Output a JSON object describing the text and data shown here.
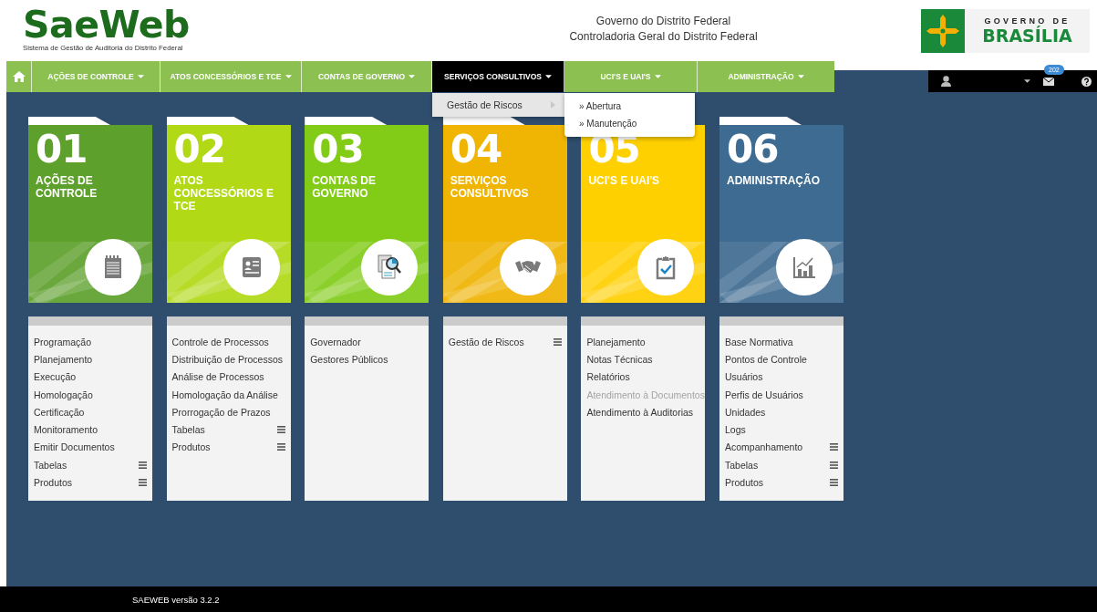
{
  "header": {
    "logo": "SaeWeb",
    "logo_subtitle": "Sistema de Gestão de Auditoria do Distrito Federal",
    "center_lines": [
      "Governo do Distrito Federal",
      "Controladoria Geral do Distrito Federal"
    ],
    "gov_logo": {
      "line_1": "GOVERNO DE",
      "line_2": "BRASÍLIA"
    }
  },
  "nav": [
    {
      "label": "AÇÕES DE CONTROLE",
      "selected": false
    },
    {
      "label": "ATOS CONCESSÓRIOS E TCE",
      "selected": false
    },
    {
      "label": "CONTAS DE GOVERNO",
      "selected": false
    },
    {
      "label": "SERVIÇOS CONSULTIVOS",
      "selected": true
    },
    {
      "label": "UCI'S E UAI'S",
      "selected": false
    },
    {
      "label": "ADMINISTRAÇÃO",
      "selected": false
    }
  ],
  "dropdown": {
    "items": [
      {
        "label": "Gestão de Riscos",
        "selected": true
      }
    ],
    "submenu": [
      {
        "label": "» Abertura"
      },
      {
        "label": "» Manutenção"
      }
    ]
  },
  "user_bar": {
    "mail_badge": "202"
  },
  "modules": [
    {
      "number": "01",
      "title": "AÇÕES DE CONTROLE",
      "color": "#5ea02c",
      "kind": "notepad",
      "items": [
        {
          "label": "Programação",
          "disabled": false,
          "submenu": false
        },
        {
          "label": "Planejamento",
          "disabled": false,
          "submenu": false
        },
        {
          "label": "Execução",
          "disabled": false,
          "submenu": false
        },
        {
          "label": "Homologação",
          "disabled": false,
          "submenu": false
        },
        {
          "label": "Certificação",
          "disabled": false,
          "submenu": false
        },
        {
          "label": "Monitoramento",
          "disabled": false,
          "submenu": false
        },
        {
          "label": "Emitir Documentos",
          "disabled": false,
          "submenu": false
        },
        {
          "label": "Tabelas",
          "disabled": false,
          "submenu": true
        },
        {
          "label": "Produtos",
          "disabled": false,
          "submenu": true
        }
      ]
    },
    {
      "number": "02",
      "title": "ATOS CONCESSÓRIOS E TCE",
      "color": "#b1d916",
      "kind": "id-card",
      "items": [
        {
          "label": "Controle de Processos",
          "disabled": false,
          "submenu": false
        },
        {
          "label": "Distribuição de Processos",
          "disabled": false,
          "submenu": false
        },
        {
          "label": "Análise de Processos",
          "disabled": false,
          "submenu": false
        },
        {
          "label": "Homologação da Análise",
          "disabled": false,
          "submenu": false
        },
        {
          "label": "Prorrogação de Prazos",
          "disabled": false,
          "submenu": false
        },
        {
          "label": "Tabelas",
          "disabled": false,
          "submenu": true
        },
        {
          "label": "Produtos",
          "disabled": false,
          "submenu": true
        }
      ]
    },
    {
      "number": "03",
      "title": "CONTAS DE GOVERNO",
      "color": "#82cc18",
      "kind": "document-search",
      "items": [
        {
          "label": "Governador",
          "disabled": false,
          "submenu": false
        },
        {
          "label": "Gestores Públicos",
          "disabled": false,
          "submenu": false
        }
      ]
    },
    {
      "number": "04",
      "title": "SERVIÇOS CONSULTIVOS",
      "color": "#f0b402",
      "kind": "handshake",
      "items": [
        {
          "label": "Gestão de Riscos",
          "disabled": false,
          "submenu": true
        }
      ]
    },
    {
      "number": "05",
      "title": "UCI'S E UAI'S",
      "color": "#ffd000",
      "kind": "clipboard",
      "items": [
        {
          "label": "Planejamento",
          "disabled": false,
          "submenu": false
        },
        {
          "label": "Notas Técnicas",
          "disabled": false,
          "submenu": false
        },
        {
          "label": "Relatórios",
          "disabled": false,
          "submenu": false
        },
        {
          "label": "Atendimento à Documentos",
          "disabled": true,
          "submenu": false
        },
        {
          "label": "Atendimento à Auditorias",
          "disabled": false,
          "submenu": false
        }
      ]
    },
    {
      "number": "06",
      "title": "ADMINISTRAÇÃO",
      "color": "#3e6b91",
      "kind": "chart",
      "items": [
        {
          "label": "Base Normativa",
          "disabled": false,
          "submenu": false
        },
        {
          "label": "Pontos de Controle",
          "disabled": false,
          "submenu": false
        },
        {
          "label": "Usuários",
          "disabled": false,
          "submenu": false
        },
        {
          "label": "Perfis de Usuários",
          "disabled": false,
          "submenu": false
        },
        {
          "label": "Unidades",
          "disabled": false,
          "submenu": false
        },
        {
          "label": "Logs",
          "disabled": false,
          "submenu": false
        },
        {
          "label": "Acompanhamento",
          "disabled": false,
          "submenu": true
        },
        {
          "label": "Tabelas",
          "disabled": false,
          "submenu": true
        },
        {
          "label": "Produtos",
          "disabled": false,
          "submenu": true
        }
      ]
    }
  ],
  "footer": "SAEWEB versão 3.2.2"
}
